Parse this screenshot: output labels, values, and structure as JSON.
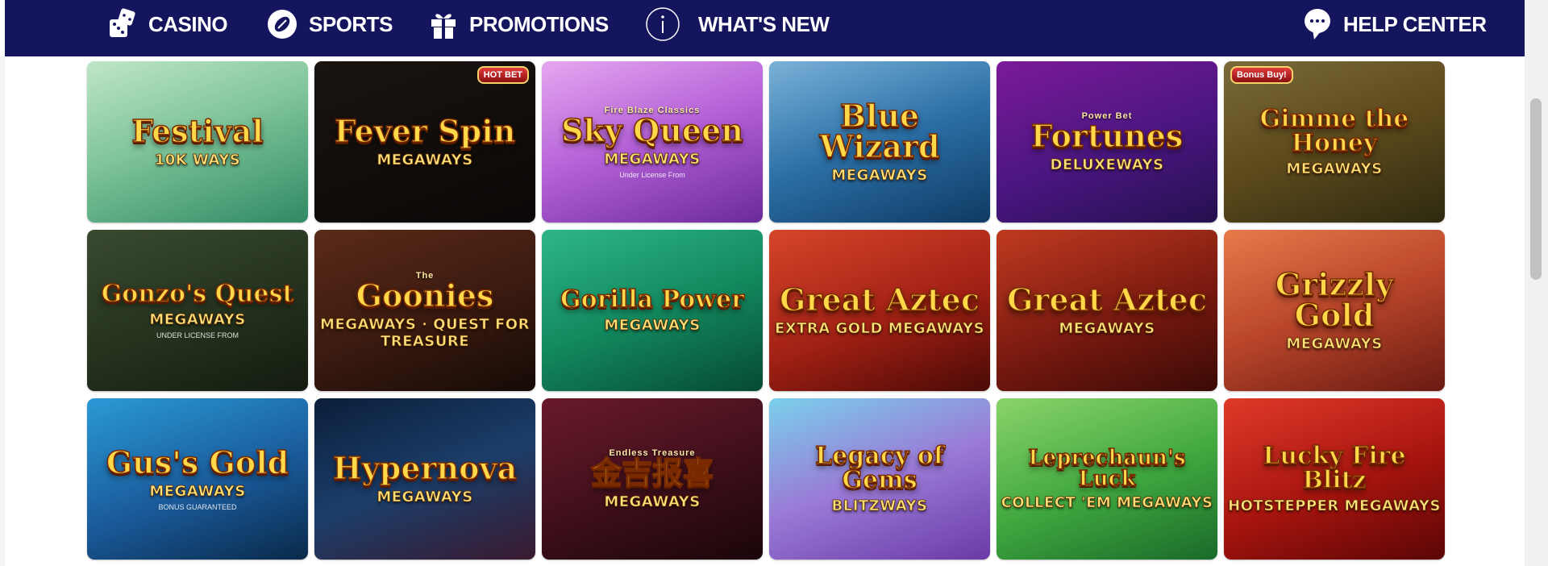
{
  "nav": {
    "casino": "CASINO",
    "sports": "SPORTS",
    "promotions": "PROMOTIONS",
    "whats_new": "WHAT'S NEW",
    "help": "HELP CENTER"
  },
  "icons": {
    "casino": "dice-icon",
    "sports": "football-icon",
    "promotions": "gift-icon",
    "whats_new": "info-icon",
    "help": "chat-bubble-icon"
  },
  "colors": {
    "nav_bg": "#15155e",
    "nav_text": "#ffffff"
  },
  "games": [
    {
      "top": "",
      "title": "Festival",
      "tag": "10K WAYS",
      "fine": "",
      "badge": ""
    },
    {
      "top": "",
      "title": "Fever Spin",
      "tag": "MEGAWAYS",
      "fine": "",
      "badge": "HOT BET"
    },
    {
      "top": "Fire Blaze Classics",
      "title": "Sky Queen",
      "tag": "MEGAWAYS",
      "fine": "Under License From",
      "badge": ""
    },
    {
      "top": "",
      "title": "Blue Wizard",
      "tag": "MEGAWAYS",
      "fine": "",
      "badge": ""
    },
    {
      "top": "Power Bet",
      "title": "Fortunes",
      "tag": "DELUXEWAYS",
      "fine": "",
      "badge": ""
    },
    {
      "top": "",
      "title": "Gimme the Honey",
      "tag": "MEGAWAYS",
      "fine": "",
      "badge": "Bonus Buy!"
    },
    {
      "top": "",
      "title": "Gonzo's Quest",
      "tag": "MEGAWAYS",
      "fine": "UNDER LICENSE FROM",
      "badge": ""
    },
    {
      "top": "The",
      "title": "Goonies",
      "tag": "MEGAWAYS · QUEST FOR TREASURE",
      "fine": "",
      "badge": ""
    },
    {
      "top": "",
      "title": "Gorilla Power",
      "tag": "MEGAWAYS",
      "fine": "",
      "badge": ""
    },
    {
      "top": "",
      "title": "Great Aztec",
      "tag": "EXTRA GOLD MEGAWAYS",
      "fine": "",
      "badge": ""
    },
    {
      "top": "",
      "title": "Great Aztec",
      "tag": "MEGAWAYS",
      "fine": "",
      "badge": ""
    },
    {
      "top": "",
      "title": "Grizzly Gold",
      "tag": "MEGAWAYS",
      "fine": "",
      "badge": ""
    },
    {
      "top": "",
      "title": "Gus's Gold",
      "tag": "MEGAWAYS",
      "fine": "BONUS GUARANTEED",
      "badge": ""
    },
    {
      "top": "",
      "title": "Hypernova",
      "tag": "MEGAWAYS",
      "fine": "",
      "badge": ""
    },
    {
      "top": "Endless Treasure",
      "title": "金吉报喜",
      "tag": "MEGAWAYS",
      "fine": "",
      "badge": ""
    },
    {
      "top": "",
      "title": "Legacy of Gems",
      "tag": "BLITZWAYS",
      "fine": "",
      "badge": ""
    },
    {
      "top": "",
      "title": "Leprechaun's Luck",
      "tag": "COLLECT 'EM MEGAWAYS",
      "fine": "",
      "badge": ""
    },
    {
      "top": "",
      "title": "Lucky Fire Blitz",
      "tag": "HOTSTEPPER MEGAWAYS",
      "fine": "",
      "badge": ""
    }
  ],
  "tile_backgrounds": [
    "linear-gradient(160deg,#bfe6c9 0%,#7fc49a 45%,#2f8a64 100%)",
    "linear-gradient(160deg,#1a1410 0%,#0b0807 100%)",
    "linear-gradient(160deg,#e6a6f0 0%,#b25ed6 50%,#6a2a9a 100%)",
    "linear-gradient(160deg,#7ab2d8 0%,#2b6fa6 50%,#0f3a63 100%)",
    "linear-gradient(160deg,#7b1a9a 0%,#4a1680 55%,#24104f 100%)",
    "linear-gradient(160deg,#7a6a3a 0%,#5d4a1c 50%,#2e2a10 100%)",
    "linear-gradient(160deg,#3a4a30 0%,#24321e 55%,#141c10 100%)",
    "linear-gradient(160deg,#5a2a18 0%,#3a1a10 55%,#150a06 100%)",
    "linear-gradient(160deg,#2fb58a 0%,#138a5f 50%,#064a32 100%)",
    "linear-gradient(160deg,#d6452a 0%,#a12014 55%,#4a0a06 100%)",
    "linear-gradient(160deg,#c03a20 0%,#7a1a10 55%,#3a0a06 100%)",
    "linear-gradient(160deg,#e77a4a 0%,#b8452a 50%,#6a1a12 100%)",
    "linear-gradient(160deg,#2a9ad6 0%,#1a5a9a 55%,#0a2a4a 100%)",
    "linear-gradient(160deg,#0b1e3a 0%,#1b3e6a 50%,#3a1a30 100%)",
    "linear-gradient(160deg,#6a1a2a 0%,#3e0f1a 55%,#1a060a 100%)",
    "linear-gradient(160deg,#7ad0ec 0%,#9a7ad6 50%,#6a3aa6 100%)",
    "linear-gradient(160deg,#8ad46a 0%,#3ea63e 55%,#1a6a2a 100%)",
    "linear-gradient(160deg,#e03a2a 0%,#a6140e 55%,#5a0606 100%)"
  ]
}
